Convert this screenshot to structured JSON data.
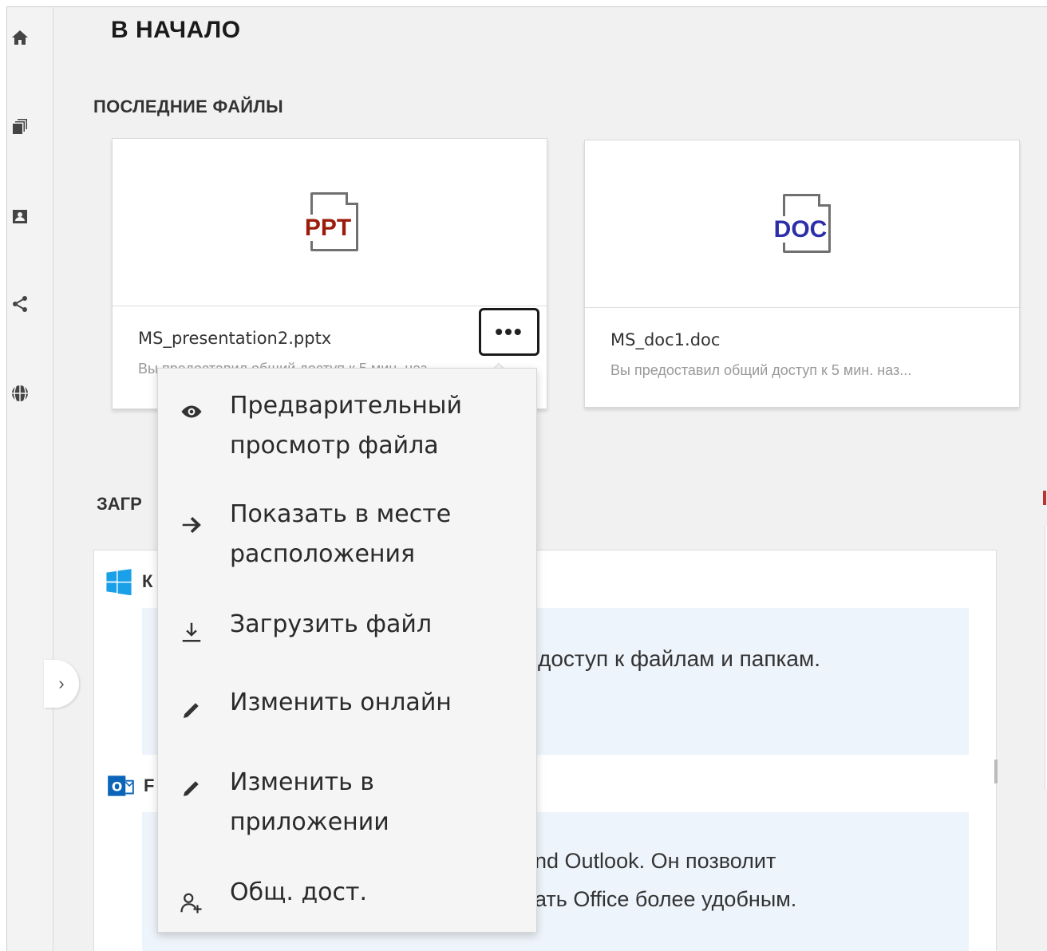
{
  "page": {
    "title": "В НАЧАЛО"
  },
  "sidebar": {
    "items": [
      {
        "name": "home",
        "icon": "home-icon"
      },
      {
        "name": "my-files",
        "icon": "files-icon"
      },
      {
        "name": "shared-with-me",
        "icon": "contact-icon"
      },
      {
        "name": "shared-by-me",
        "icon": "share-icon"
      },
      {
        "name": "net-folders",
        "icon": "globe-icon"
      }
    ],
    "collapse_glyph": "›"
  },
  "recent": {
    "title": "ПОСЛЕДНИЕ ФАЙЛЫ",
    "files": [
      {
        "ext": "PPT",
        "ext_color": "#9b1c0c",
        "name": "MS_presentation2.pptx",
        "meta": "Вы предоставил общий доступ к 5 мин. наз..."
      },
      {
        "ext": "DOC",
        "ext_color": "#2d2fa8",
        "name": "MS_doc1.doc",
        "meta": "Вы предоставил общий доступ к 5 мин. наз..."
      }
    ],
    "more_glyph": "•••"
  },
  "upload": {
    "title": "ЗАГР",
    "windows_title": "К",
    "windows_text": "доступ к файлам и папкам.",
    "outlook_title": "F",
    "outlook_text_line1": "nd Outlook. Он позволит",
    "outlook_text_line2": "ать Office более удобным."
  },
  "context_menu": {
    "items": [
      {
        "icon": "eye-icon",
        "label_line1": "Предварительный",
        "label_line2": "просмотр файла"
      },
      {
        "icon": "arrow-right-icon",
        "label_line1": "Показать в месте",
        "label_line2": "расположения"
      },
      {
        "icon": "download-icon",
        "label_line1": "Загрузить файл",
        "label_line2": ""
      },
      {
        "icon": "pencil-icon",
        "label_line1": "Изменить онлайн",
        "label_line2": ""
      },
      {
        "icon": "pencil-icon",
        "label_line1": "Изменить в",
        "label_line2": "приложении"
      },
      {
        "icon": "add-user-icon",
        "label_line1": "Общ. дост.",
        "label_line2": ""
      }
    ]
  }
}
